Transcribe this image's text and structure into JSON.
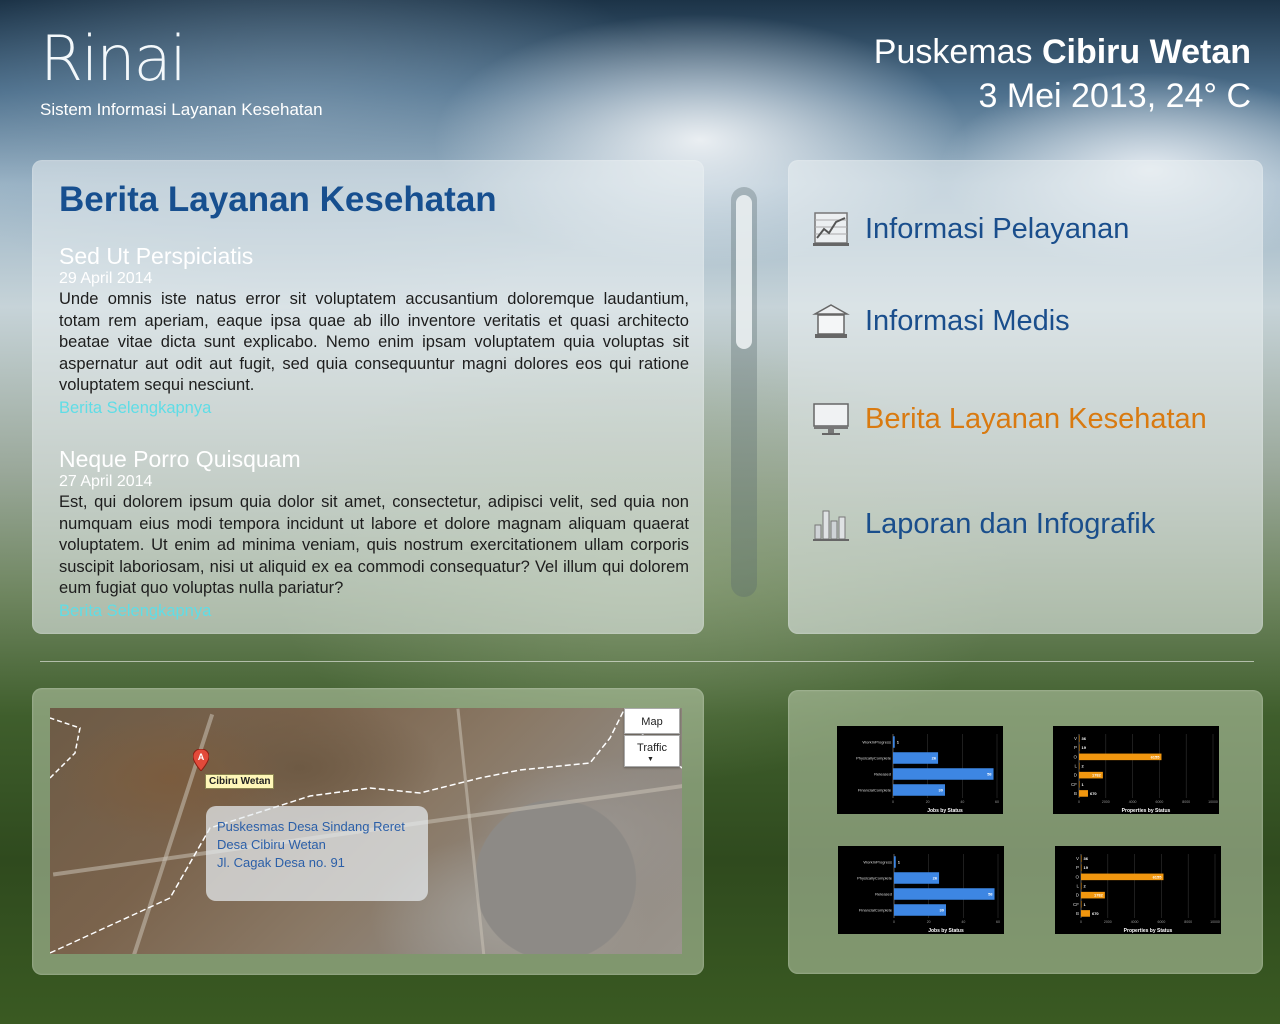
{
  "brand": {
    "logo": "Rinai",
    "subtitle": "Sistem Informasi Layanan Kesehatan"
  },
  "header": {
    "prefix": "Puskemas ",
    "name": "Cibiru Wetan",
    "date_weather": "3 Mei 2013, 24° C"
  },
  "news": {
    "title": "Berita Layanan Kesehatan",
    "articles": [
      {
        "title": "Sed Ut Perspiciatis",
        "date": "29 April 2014",
        "body": "Unde omnis iste natus error sit voluptatem accusantium doloremque laudantium, totam rem aperiam, eaque ipsa quae ab illo inventore veritatis et quasi architecto beatae vitae dicta sunt explicabo. Nemo enim ipsam voluptatem quia voluptas sit aspernatur aut odit aut fugit, sed quia consequuntur magni dolores eos qui ratione voluptatem sequi nesciunt.",
        "more": "Berita Selengkapnya"
      },
      {
        "title": "Neque Porro Quisquam",
        "date": "27 April 2014",
        "body": "Est, qui dolorem ipsum quia dolor sit amet, consectetur, adipisci velit, sed quia non numquam eius modi tempora incidunt ut labore et dolore magnam aliquam quaerat voluptatem. Ut enim ad minima veniam, quis nostrum exercitationem ullam corporis suscipit laboriosam, nisi ut aliquid ex ea commodi consequatur? Vel illum qui dolorem eum fugiat quo voluptas nulla pariatur?",
        "more": "Berita Selengkapnya"
      }
    ]
  },
  "menu": {
    "items": [
      {
        "label": "Informasi Pelayanan",
        "icon": "line-chart-icon",
        "active": false
      },
      {
        "label": "Informasi Medis",
        "icon": "building-icon",
        "active": false
      },
      {
        "label": "Berita Layanan Kesehatan",
        "icon": "monitor-icon",
        "active": true
      },
      {
        "label": "Laporan dan Infografik",
        "icon": "bar-chart-icon",
        "active": false
      }
    ],
    "active_color": "#d97a10",
    "link_color": "#1a4e8c"
  },
  "map": {
    "btn_map": "Map",
    "btn_traffic": "Traffic",
    "marker_letter": "A",
    "marker_label": "Cibiru Wetan",
    "info": {
      "line1": "Puskesmas Desa Sindang Reret",
      "line2": "Desa Cibiru Wetan",
      "line3": "Jl. Cagak Desa no. 91"
    }
  },
  "chart_data": [
    {
      "type": "bar",
      "title": "Jobs by Status",
      "categories": [
        "WorkInProgress",
        "PhysicallyComplete",
        "Released",
        "FinancialComplete"
      ],
      "values": [
        1,
        26,
        58,
        30
      ],
      "color": "#3d86e3",
      "xticks": [
        "0",
        "20",
        "40",
        "60"
      ],
      "xlim": [
        0,
        60
      ]
    },
    {
      "type": "bar",
      "title": "Properties by Status",
      "categories": [
        "V",
        "P",
        "O",
        "L",
        "D",
        "CF",
        "B"
      ],
      "values": [
        36,
        19,
        6155,
        2,
        1782,
        1,
        670
      ],
      "color": "#f0960f",
      "xticks": [
        "0",
        "2000",
        "4000",
        "6000",
        "8000",
        "10000"
      ],
      "xlim": [
        0,
        10000
      ]
    },
    {
      "type": "bar",
      "title": "Jobs by Status",
      "categories": [
        "WorkInProgress",
        "PhysicallyComplete",
        "Released",
        "FinancialComplete"
      ],
      "values": [
        1,
        26,
        58,
        30
      ],
      "color": "#3d86e3",
      "xticks": [
        "0",
        "20",
        "40",
        "60"
      ],
      "xlim": [
        0,
        60
      ]
    },
    {
      "type": "bar",
      "title": "Properties by Status",
      "categories": [
        "V",
        "P",
        "O",
        "L",
        "D",
        "CF",
        "B"
      ],
      "values": [
        36,
        19,
        6155,
        2,
        1782,
        1,
        670
      ],
      "color": "#f0960f",
      "xticks": [
        "0",
        "2000",
        "4000",
        "6000",
        "8000",
        "10000"
      ],
      "xlim": [
        0,
        10000
      ]
    }
  ]
}
